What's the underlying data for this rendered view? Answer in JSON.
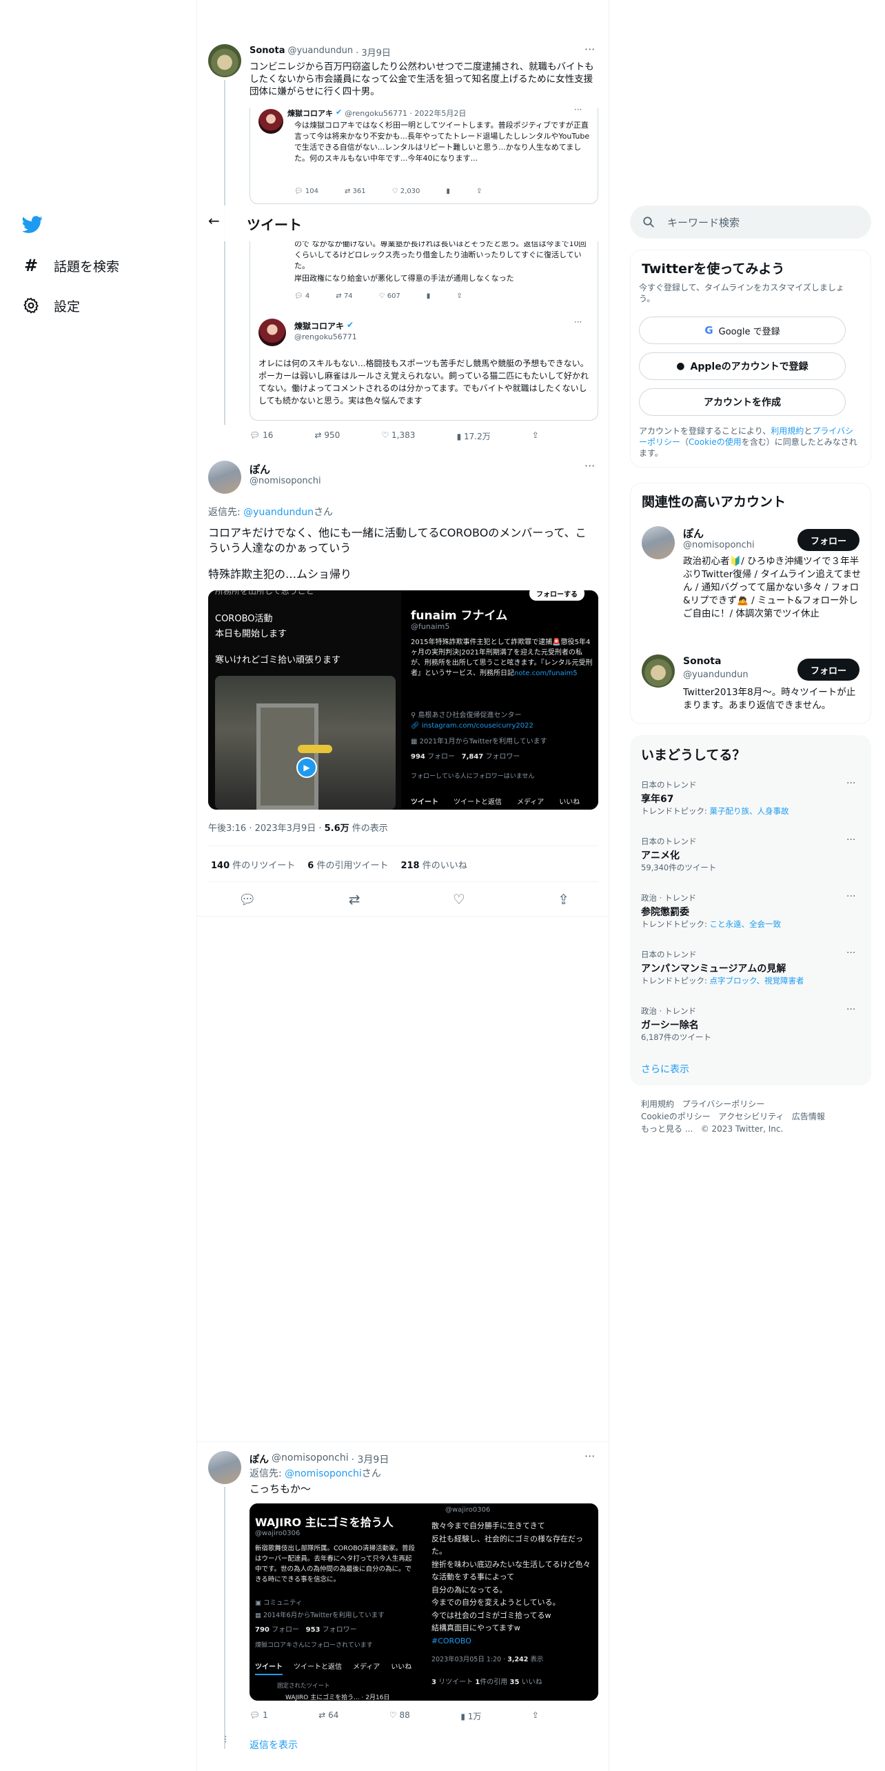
{
  "nav": {
    "items": [
      {
        "icon": "hashtag-icon",
        "label": "話題を検索"
      },
      {
        "icon": "gear-icon",
        "label": "設定"
      }
    ]
  },
  "header": {
    "title": "ツイート",
    "back": "←"
  },
  "search": {
    "placeholder": "キーワード検索"
  },
  "signup": {
    "title": "Twitterを使ってみよう",
    "desc": "今すぐ登録して、タイムラインをカスタマイズしましょう。",
    "google": "Google で登録",
    "apple": "Appleのアカウントで登録",
    "create": "アカウントを作成",
    "terms_1": "アカウントを登録することにより、",
    "terms_link1": "利用規約",
    "terms_2": "と",
    "terms_link2": "プライバシーポリシー",
    "terms_3": "（",
    "terms_link3": "Cookieの使用",
    "terms_4": "を含む）に同意したとみなされます。"
  },
  "related": {
    "title": "関連性の高いアカウント",
    "accounts": [
      {
        "name": "ぽん",
        "handle": "@nomisoponchi",
        "follow": "フォロー",
        "bio": "政治初心者🔰/ ひろゆき沖縄ツイで３年半ぶりTwitter復帰 / タイムライン追えてません / 通知バグってて届かない多々 / フォロ&リプできず🙇 / ミュート&フォロー外しご自由に！/ 体調次第でツイ休止"
      },
      {
        "name": "Sonota",
        "handle": "@yuandundun",
        "follow": "フォロー",
        "bio": "Twitter2013年8月～。時々ツイートが止まります。あまり返信できません。"
      }
    ]
  },
  "trends": {
    "title": "いまどうしてる？",
    "items": [
      {
        "context": "日本のトレンド",
        "name": "享年67",
        "meta_prefix": "トレンドトピック: ",
        "meta_link": "菓子配り族、人身事故",
        "meta": ""
      },
      {
        "context": "日本のトレンド",
        "name": "アニメ化",
        "meta_prefix": "",
        "meta_link": "",
        "meta": "59,340件のツイート"
      },
      {
        "context": "政治 · トレンド",
        "name": "参院懲罰委",
        "meta_prefix": "トレンドトピック: ",
        "meta_link": "こと永遠、全会一致",
        "meta": ""
      },
      {
        "context": "日本のトレンド",
        "name": "アンパンマンミュージアムの見解",
        "meta_prefix": "トレンドトピック: ",
        "meta_link": "点字ブロック、視覚障害者",
        "meta": ""
      },
      {
        "context": "政治 · トレンド",
        "name": "ガーシー除名",
        "meta_prefix": "",
        "meta_link": "",
        "meta": "6,187件のツイート"
      }
    ],
    "more": "さらに表示"
  },
  "footer": {
    "l1": [
      "利用規約",
      "プライバシーポリシー"
    ],
    "l2": [
      "Cookieのポリシー",
      "アクセシビリティ",
      "広告情報"
    ],
    "more": "もっと見る ...",
    "copy": "© 2023 Twitter, Inc."
  },
  "tweet1": {
    "name": "Sonota",
    "handle": "@yuandundun",
    "date": "· 3月9日",
    "text": "コンビニレジから百万円窃盗したり公然わいせつで二度逮捕され、就職もバイトもしたくないから市会議員になって公金で生活を狙って知名度上げるために女性支援団体に嫌がらせに行く四十男。",
    "q1": {
      "name": "煉獄コロアキ",
      "handle": "@rengoku56771 · 2022年5月2日",
      "text": "今は煉獄コロアキではなく杉田一明としてツイートします。普段ポジティブですが正直言って今は将来かなり不安かも...長年やってたトレード退場したしレンタルやYouTubeで生活できる自信がない...レンタルはリピート難しいと思う...かなり人生なめてました。何のスキルもない中年です...今年40になります...",
      "reply": "104",
      "rt": "361",
      "like": "2,030"
    },
    "q2": {
      "text_top": "ので なかなか働けない。専業塾が長ければ長いほどそうだと思う。返信は今まで10回くらいしてるけどロレックス売ったり借金したり油断いったりしてすぐに復活していた。",
      "text_top2": "岸田政権になり給金いが悪化して得意の手法が通用しなくなった",
      "reply": "4",
      "rt": "74",
      "like": "607"
    },
    "q3": {
      "name": "煉獄コロアキ",
      "handle": "@rengoku56771",
      "text": "オレには何のスキルもない...格闘技もスポーツも苦手だし競馬や競艇の予想もできない。ポーカーは弱いし麻雀はルールさえ覚えられない。飼っている猫二匹にもたいして好かれてない。働けよってコメントされるのは分かってます。でもバイトや就職はしたくないししても続かないと思う。実は色々悩んでます"
    },
    "reply": "16",
    "rt": "950",
    "like": "1,383",
    "views": "17.2万"
  },
  "main": {
    "name": "ぽん",
    "handle": "@nomisoponchi",
    "reply_to_label": "返信先: ",
    "reply_to_user": "@yuandundun",
    "reply_to_suffix": "さん",
    "text1": "コロアキだけでなく、他にも一緒に活動してるCOROBOのメンバーって、こういう人達なのかぁっていう",
    "text2": "特殊詐欺主犯の…ムショ帰り",
    "media_left": {
      "top_cut": "所務所を出所して思うこと",
      "l1": "COROBO活動",
      "l2": "本日も開始します",
      "l3": "寒いけれどゴミ拾い頑張ります"
    },
    "media_right": {
      "follow": "フォローする",
      "name": "funaim フナイム",
      "handle": "@funaim5",
      "bio": "2015年特殊詐欺事件主犯として詐欺罪で逮捕🚨懲役5年4ヶ月の実刑判決|2021年刑期満了を迎えた元受刑者の私が、刑務所を出所して思うこと呟きます。『レンタル元受刑者』というサービス、刑務所日記",
      "bio_link": "note.com/funaim5",
      "loc": "島根あさひ社会復帰促進センター",
      "ig": "instagram.com/couseicurry2022",
      "joined": "2021年1月からTwitterを利用しています",
      "following": "994",
      "following_label": "フォロー",
      "followers": "7,847",
      "followers_label": "フォロワー",
      "note": "フォローしている人にフォロワーはいません",
      "tabs": [
        "ツイート",
        "ツイートと返信",
        "メディア",
        "いいね"
      ]
    },
    "time": "午後3:16 · 2023年3月9日 · ",
    "views": "5.6万",
    "views_label": " 件の表示",
    "rts": "140",
    "rts_label": " 件のリツイート",
    "quotes": "6",
    "quotes_label": " 件の引用ツイート",
    "likes": "218",
    "likes_label": " 件のいいね"
  },
  "tweet3": {
    "name": "ぽん",
    "handle": "@nomisoponchi",
    "date": "· 3月9日",
    "reply_to_label": "返信先: ",
    "reply_to_user": "@nomisoponchi",
    "reply_to_suffix": "さん",
    "text": "こっちもか〜",
    "m_left": {
      "title": "WAJIRO 主にゴミを拾う人",
      "handle": "@wajiro0306",
      "bio": "新宿歌舞伎出し部隊所属。COROBO清掃活動家。普段はウーバー配達員。去年春にヘタ打って只今人生再起中です。世の為人の為仲間の為最後に自分の為に。できる時にできる事を信念に。",
      "community": "コミュニティ",
      "joined": "2014年6月からTwitterを利用しています",
      "following": "790",
      "following_label": "フォロー",
      "followers": "953",
      "followers_label": "フォロワー",
      "followed_by": "煉獄コロアキさんにフォローされています",
      "tabs": [
        "ツイート",
        "ツイートと返信",
        "メディア",
        "いいね"
      ],
      "pinned": "固定されたツイート",
      "pinned_text": "WAJIRO 主にゴミを拾う... · 2月16日"
    },
    "m_right": {
      "handle": "@wajiro0306",
      "lines": [
        "散々今まで自分勝手に生きてきて",
        "反社も経験し、社会的にゴミの様な存在だった。",
        "挫折を味わい底辺みたいな生活してるけど色々な活動をする事によって",
        "自分の為になってる。",
        "今までの自分を変えようとしている。",
        "今では社会のゴミがゴミ拾ってるw",
        "結構真面目にやってますw"
      ],
      "tag": "#COROBO",
      "time": "2023年03月05日 1:20 · ",
      "views": "3,242",
      "views_label": " 表示",
      "rt": "3",
      "rt_label": " リツイート ",
      "quote": "1",
      "quote_label": "件の引用 ",
      "like": "35",
      "like_label": " いいね"
    },
    "reply": "1",
    "rt": "64",
    "like": "88",
    "views": "1万",
    "show_replies": "返信を表示"
  },
  "colors": {
    "accent": "#1d9bf0",
    "text": "#0f1419",
    "muted": "#536471",
    "border": "#eff3f4"
  }
}
